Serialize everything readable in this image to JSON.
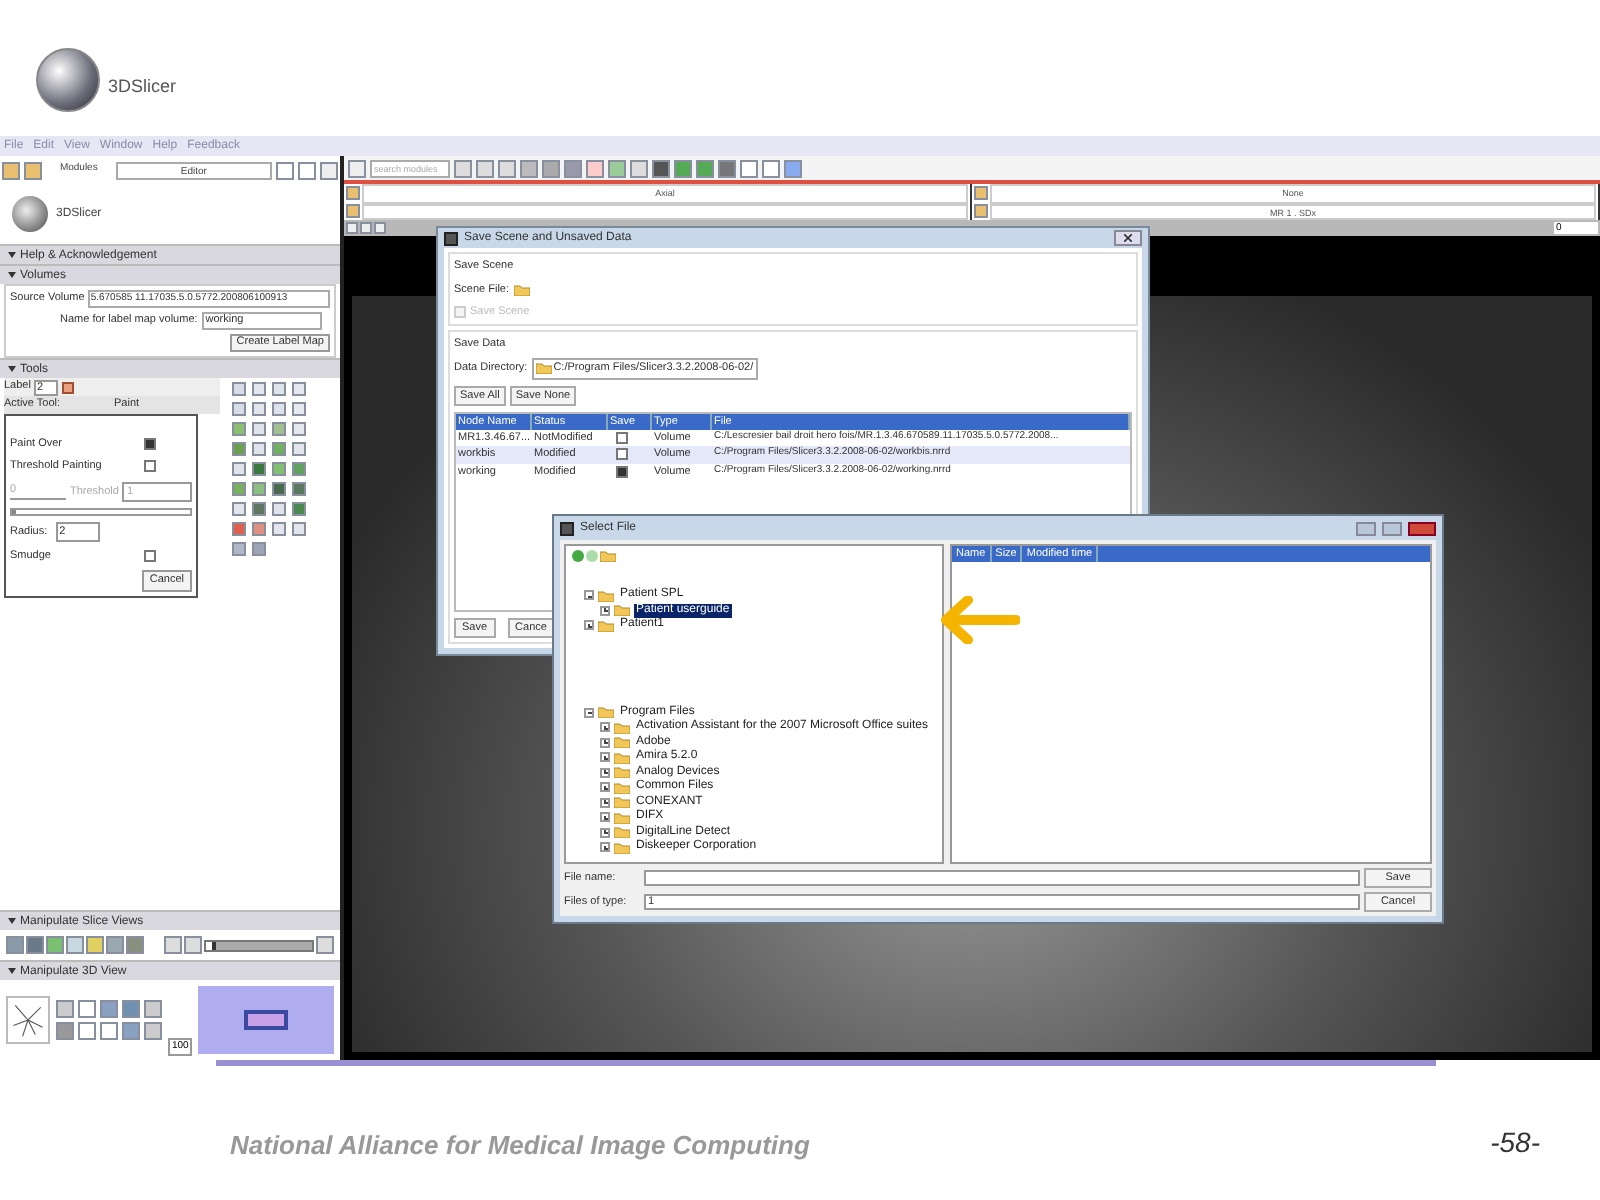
{
  "logo": {
    "text": "3DSlicer"
  },
  "menu": [
    "File",
    "Edit",
    "View",
    "Window",
    "Help",
    "Feedback"
  ],
  "module_bar": {
    "label": "Modules",
    "module": "Editor"
  },
  "panel_logo": {
    "text": "3DSlicer"
  },
  "help": {
    "title": "Help & Acknowledgement"
  },
  "volumes": {
    "title": "Volumes",
    "source_label": "Source Volume",
    "source_value": "5.670585 11.17035.5.0.5772.200806100913",
    "name_label": "Name for label map volume:",
    "name_value": "working",
    "button": "Create Label Map"
  },
  "tools": {
    "title": "Tools",
    "label_label": "Label",
    "label_value": "2",
    "active_tool_label": "Active Tool:",
    "active_tool": "Paint",
    "options": [
      {
        "label": "Paint Over",
        "checked": true
      },
      {
        "label": "Threshold Painting",
        "checked": false
      }
    ],
    "threshold_label": "Threshold",
    "threshold_slider": {
      "level": 0.02
    },
    "threshold_min": "0",
    "threshold_max": "1",
    "radius_label": "Radius:",
    "radius": "2",
    "smudge": {
      "label": "Smudge",
      "checked": false
    },
    "cancel": "Cancel"
  },
  "slice_views": {
    "title": "Manipulate Slice Views",
    "level": 0.1
  },
  "view_3d": {
    "title": "Manipulate 3D View",
    "zoom": "100"
  },
  "search": {
    "placeholder": "search modules"
  },
  "viewers": [
    {
      "orientation": "Axial"
    },
    {
      "orientation": "None",
      "volume": "MR 1 . SDx"
    }
  ],
  "offset_value": "0",
  "save_dialog": {
    "title": "Save Scene and Unsaved Data",
    "scene_section": "Save Scene",
    "scene_file_label": "Scene File:",
    "save_scene": {
      "label": "Save Scene",
      "disabled": true
    },
    "data_section": "Save Data",
    "directory_label": "Data Directory:",
    "directory": "C:/Program Files/Slicer3.3.2.2008-06-02/",
    "buttons": [
      "Save All",
      "Save None"
    ],
    "columns": [
      "Node Name",
      "Status",
      "Save",
      "Type",
      "File"
    ],
    "rows": [
      {
        "node": "MR1.3.46.67...",
        "status": "NotModified",
        "save": false,
        "type": "Volume",
        "file": "C:/Lescresier bail droit hero fois/MR.1.3.46.670589.11.17035.5.0.5772.2008...",
        "selected": false
      },
      {
        "node": "workbis",
        "status": "Modified",
        "save": false,
        "type": "Volume",
        "file": "C:/Program Files/Slicer3.3.2.2008-06-02/workbis.nrrd",
        "selected": true
      },
      {
        "node": "working",
        "status": "Modified",
        "save": true,
        "type": "Volume",
        "file": "C:/Program Files/Slicer3.3.2.2008-06-02/working.nrrd",
        "selected": false
      }
    ],
    "save_button": "Save",
    "cancel_button": "Cance"
  },
  "file_dialog": {
    "title": "Select File",
    "tree": [
      {
        "label": "Patient SPL",
        "expanded": true,
        "selected": false,
        "children": [
          {
            "label": "Patient userguide",
            "expanded": false,
            "selected": true
          }
        ]
      },
      {
        "label": "Patient1",
        "expanded": false,
        "selected": false
      },
      {
        "label": "Program Files",
        "expanded": true,
        "selected": false,
        "children": [
          {
            "label": "Activation Assistant for the 2007 Microsoft Office suites",
            "expanded": false,
            "selected": false
          },
          {
            "label": "Adobe",
            "expanded": false,
            "selected": false
          },
          {
            "label": "Amira 5.2.0",
            "expanded": false,
            "selected": false
          },
          {
            "label": "Analog Devices",
            "expanded": false,
            "selected": false
          },
          {
            "label": "Common Files",
            "expanded": false,
            "selected": false
          },
          {
            "label": "CONEXANT",
            "expanded": false,
            "selected": false
          },
          {
            "label": "DIFX",
            "expanded": false,
            "selected": false
          },
          {
            "label": "DigitalLine Detect",
            "expanded": false,
            "selected": false
          },
          {
            "label": "Diskeeper Corporation",
            "expanded": false,
            "selected": false
          }
        ]
      }
    ],
    "columns": [
      "Name",
      "Size",
      "Modified time"
    ],
    "file_name_label": "File name:",
    "file_type_label": "Files of type:",
    "file_type": "1",
    "save_button": "Save",
    "cancel_button": "Cancel"
  },
  "footer": {
    "text": "National Alliance for Medical Image Computing",
    "page": "-58-"
  }
}
